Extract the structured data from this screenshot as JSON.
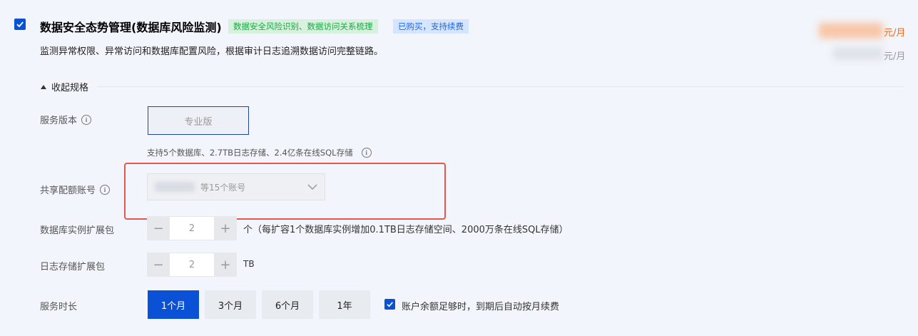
{
  "product": {
    "title": "数据安全态势管理(数据库风险监测)",
    "tags": [
      "数据安全风险识别、数据访问关系梳理",
      "已购买，支持续费"
    ],
    "description": "监测异常权限、异常访问和数据库配置风险，根据审计日志追溯数据访问完整链路。",
    "price_unit_primary": "元/月",
    "price_unit_secondary": "元/月",
    "selected": true
  },
  "spec": {
    "collapse_label": "收起规格",
    "version_label": "服务版本",
    "version_value": "专业版",
    "version_hint": "支持5个数据库、2.7TB日志存储、2.4亿条在线SQL存储",
    "account_label": "共享配额账号",
    "account_value_suffix": "等15个账号",
    "db_instance_label": "数据库实例扩展包",
    "db_instance_value": "2",
    "db_instance_unit": "个（每扩容1个数据库实例增加0.1TB日志存储空间、2000万条在线SQL存储）",
    "log_storage_label": "日志存储扩展包",
    "log_storage_value": "2",
    "log_storage_unit": "TB",
    "duration_label": "服务时长",
    "durations": [
      "1个月",
      "3个月",
      "6个月",
      "1年"
    ],
    "selected_duration": "1个月",
    "auto_renew_label": "账户余额足够时，到期后自动按月续费",
    "auto_renew_checked": true
  },
  "colors": {
    "accent": "#0a51d6",
    "price": "#f06a1e",
    "highlight": "#e5564b"
  }
}
